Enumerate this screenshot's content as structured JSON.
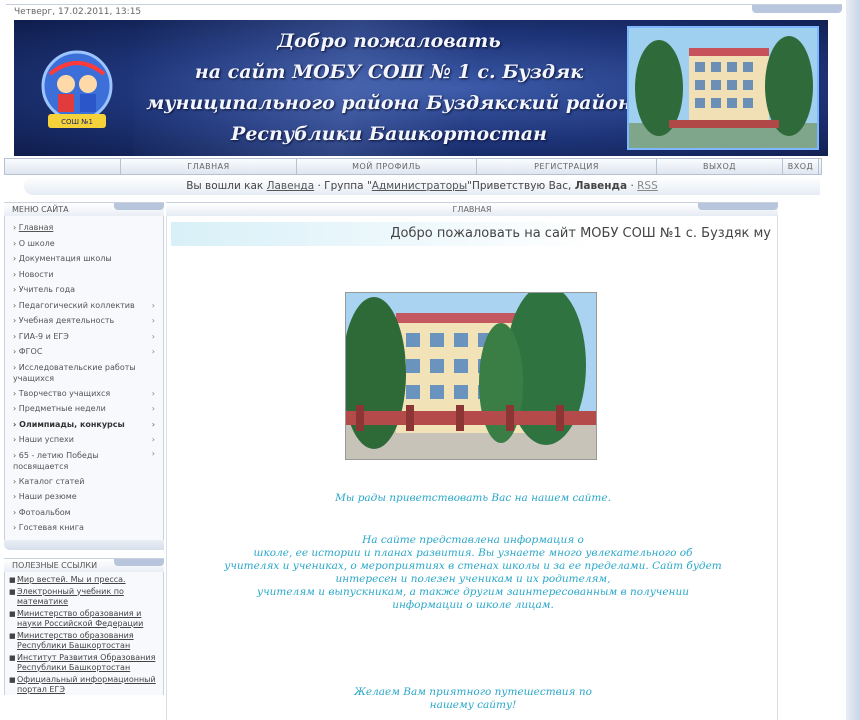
{
  "topline": {
    "text": "Четверг, 17.02.2011, 13:15"
  },
  "header": {
    "title_lines": [
      "Добро пожаловать",
      "на сайт МОБУ СОШ № 1 с. Буздяк",
      "муниципального района Буздякский район",
      "Республики Башкортостан"
    ],
    "logo_text": "СОШ №1"
  },
  "nav": {
    "items": [
      "",
      "ГЛАВНАЯ",
      "МОЙ ПРОФИЛЬ",
      "РЕГИСТРАЦИЯ",
      "ВЫХОД",
      "ВХОД"
    ]
  },
  "userbar": {
    "prefix": "Вы вошли как",
    "username": "Лавенда",
    "group_prefix": "· Группа \"",
    "group": "Администраторы",
    "greeting": "\"Приветствую Вас, ",
    "name_bold": "Лавенда",
    "rss": "RSS"
  },
  "sidebar": {
    "menu_title": "МЕНЮ САЙТА",
    "menu": [
      {
        "label": "Главная",
        "arrow": false,
        "underline": true
      },
      {
        "label": "О школе",
        "arrow": false
      },
      {
        "label": "Документация школы",
        "arrow": false
      },
      {
        "label": "Новости",
        "arrow": false
      },
      {
        "label": "Учитель года",
        "arrow": false
      },
      {
        "label": "Педагогический коллектив",
        "arrow": true
      },
      {
        "label": "Учебная деятельность",
        "arrow": true
      },
      {
        "label": "ГИА-9 и ЕГЭ",
        "arrow": true
      },
      {
        "label": "ФГОС",
        "arrow": true
      },
      {
        "label": "Исследовательские работы учащихся",
        "arrow": false,
        "two": true
      },
      {
        "label": "Творчество учащихся",
        "arrow": true
      },
      {
        "label": "Предметные недели",
        "arrow": true
      },
      {
        "label": "Олимпиады, конкурсы",
        "arrow": true,
        "bold": true
      },
      {
        "label": "Наши успехи",
        "arrow": true
      },
      {
        "label": "65 - летию Победы посвящается",
        "arrow": true,
        "two": true
      },
      {
        "label": "Каталог статей",
        "arrow": false
      },
      {
        "label": "Наши резюме",
        "arrow": false
      },
      {
        "label": "Фотоальбом",
        "arrow": false
      },
      {
        "label": "Гостевая книга",
        "arrow": false
      }
    ],
    "links_title": "ПОЛЕЗНЫЕ ССЫЛКИ",
    "links": [
      "Мир вестей. Мы и пресса.",
      "Электронный учебник по математике",
      "Министерство образования и науки Российской Федерации",
      "Министерство образования Республики Башкортостан",
      "Институт Развития Образования Республики Башкортостан",
      "Официальный информационный портал ЕГЭ"
    ]
  },
  "main": {
    "header": "ГЛАВНАЯ",
    "welcome": "Добро пожаловать на сайт МОБУ СОШ №1 с. Буздяк му",
    "greeting_lines_1": [
      "Мы рады приветствовать Вас на нашем сайте."
    ],
    "greeting_lines_2": [
      "На сайте представлена информация о",
      "школе, ее истории и планах развития. Вы узнаете много увлекательного об",
      "учителях и учениках, о мероприятиях в стенах школы и за ее пределами. Сайт будет",
      "интересен и полезен ученикам и их родителям,",
      "учителям и выпускникам, а также другим заинтересованным в получении",
      "информации о школе лицам."
    ],
    "greeting_lines_3": [
      "Желаем Вам приятного путешествия по",
      "нашему сайту!"
    ]
  },
  "colors": {
    "header_blue": "#1e3478",
    "greeting_text": "#2aa7c9"
  }
}
